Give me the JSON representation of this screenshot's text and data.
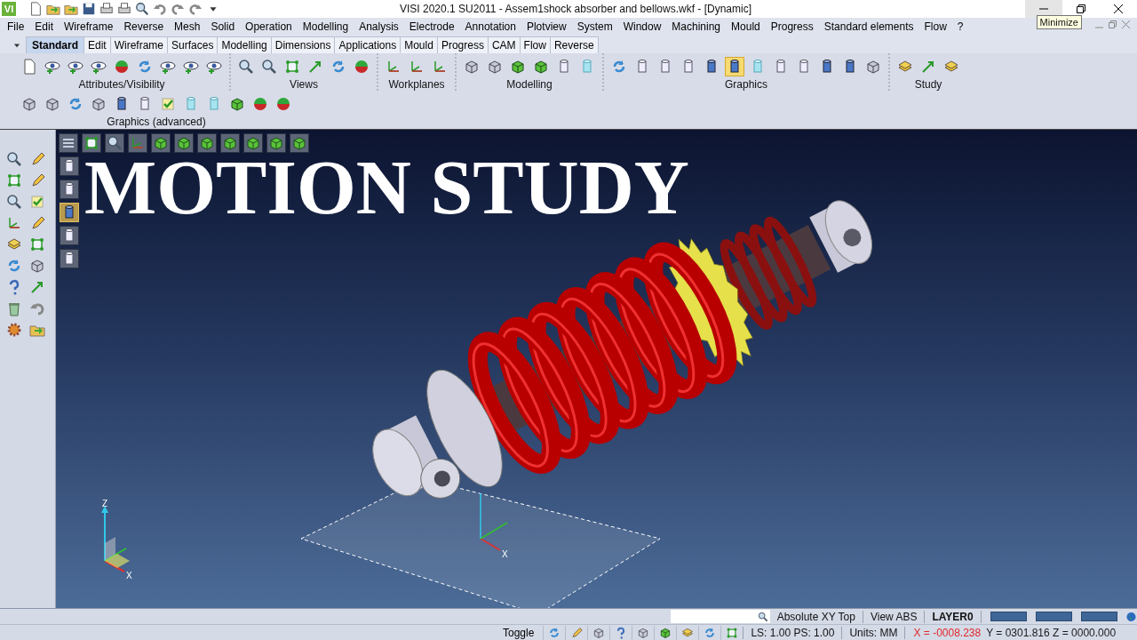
{
  "window": {
    "logo": "VI",
    "title": "VISI 2020.1 SU2011 - Assem1shock absorber and bellows.wkf - [Dynamic]",
    "tooltip": "Minimize"
  },
  "menu": [
    "File",
    "Edit",
    "Wireframe",
    "Reverse",
    "Mesh",
    "Solid",
    "Operation",
    "Modelling",
    "Analysis",
    "Electrode",
    "Annotation",
    "Plotview",
    "System",
    "Window",
    "Machining",
    "Mould",
    "Progress",
    "Standard elements",
    "Flow",
    "?"
  ],
  "tabs": [
    {
      "label": "Standard",
      "selected": true
    },
    {
      "label": "Edit",
      "selected": false
    },
    {
      "label": "Wireframe",
      "selected": false
    },
    {
      "label": "Surfaces",
      "selected": false
    },
    {
      "label": "Modelling",
      "selected": false
    },
    {
      "label": "Dimensions",
      "selected": false
    },
    {
      "label": "Applications",
      "selected": false
    },
    {
      "label": "Mould",
      "selected": false
    },
    {
      "label": "Progress",
      "selected": false
    },
    {
      "label": "CAM",
      "selected": false
    },
    {
      "label": "Flow",
      "selected": false
    },
    {
      "label": "Reverse",
      "selected": false
    }
  ],
  "ribbon": [
    {
      "label": "Attributes/Visibility"
    },
    {
      "label": "Views"
    },
    {
      "label": "Workplanes"
    },
    {
      "label": "Modelling"
    },
    {
      "label": "Graphics",
      "buttons": [
        {
          "selected": false
        },
        {
          "selected": false
        },
        {
          "selected": false
        },
        {
          "selected": false
        },
        {
          "selected": false
        },
        {
          "selected": true
        },
        {
          "selected": false
        },
        {
          "selected": false
        },
        {
          "selected": false
        },
        {
          "selected": false
        },
        {
          "selected": false
        },
        {
          "selected": false
        }
      ]
    },
    {
      "label": "Study"
    }
  ],
  "ribbon_row_2": [
    {
      "label": "Graphics (advanced)"
    }
  ],
  "viewport": {
    "overlay_title": "MOTION STUDY",
    "display_modes": [
      {
        "selected": false
      },
      {
        "selected": false
      },
      {
        "selected": true
      },
      {
        "selected": false
      },
      {
        "selected": false
      }
    ],
    "axis_triad": {
      "z": "Z",
      "x": "X"
    },
    "origin_triad": {
      "x": "X"
    }
  },
  "status_bar": {
    "view": "Absolute XY Top",
    "view_mode": "View ABS",
    "layer": "LAYER0",
    "toggle": "Toggle",
    "scale": "LS: 1.00 PS: 1.00",
    "units": "Units: MM",
    "coordinates": [
      {
        "text": "X = -0008.238",
        "color": "#e0282c"
      },
      {
        "text": "Y = 0301.816 Z = 0000.000",
        "color": "#1a1a1a"
      }
    ]
  }
}
